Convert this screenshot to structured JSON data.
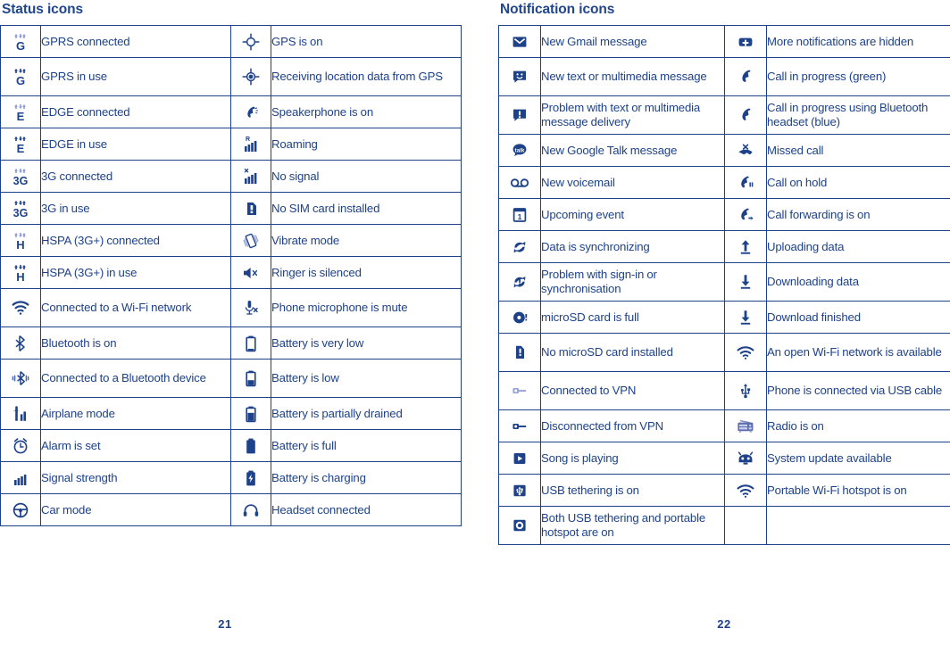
{
  "status_section": {
    "title": "Status icons",
    "page_number": "21",
    "rows": [
      {
        "left_icon": "gprs-connected-icon",
        "left_label": "GPRS connected",
        "right_icon": "gps-on-icon",
        "right_label": "GPS is on"
      },
      {
        "left_icon": "gprs-in-use-icon",
        "left_label": "GPRS in use",
        "right_icon": "gps-receiving-icon",
        "right_label": "Receiving location data from GPS"
      },
      {
        "left_icon": "edge-connected-icon",
        "left_label": "EDGE connected",
        "right_icon": "speakerphone-on-icon",
        "right_label": "Speakerphone is on"
      },
      {
        "left_icon": "edge-in-use-icon",
        "left_label": "EDGE in use",
        "right_icon": "roaming-icon",
        "right_label": "Roaming"
      },
      {
        "left_icon": "3g-connected-icon",
        "left_label": "3G connected",
        "right_icon": "no-signal-icon",
        "right_label": "No signal"
      },
      {
        "left_icon": "3g-in-use-icon",
        "left_label": "3G in use",
        "right_icon": "no-sim-card-icon",
        "right_label": "No SIM card installed"
      },
      {
        "left_icon": "hspa-connected-icon",
        "left_label": "HSPA (3G+) connected",
        "right_icon": "vibrate-mode-icon",
        "right_label": "Vibrate mode"
      },
      {
        "left_icon": "hspa-in-use-icon",
        "left_label": "HSPA (3G+) in use",
        "right_icon": "ringer-silenced-icon",
        "right_label": "Ringer is silenced"
      },
      {
        "left_icon": "wifi-connected-icon",
        "left_label": "Connected to a Wi-Fi network",
        "right_icon": "microphone-mute-icon",
        "right_label": "Phone microphone is mute"
      },
      {
        "left_icon": "bluetooth-on-icon",
        "left_label": "Bluetooth is on",
        "right_icon": "battery-very-low-icon",
        "right_label": "Battery is very low"
      },
      {
        "left_icon": "bluetooth-connected-icon",
        "left_label": "Connected to a Bluetooth device",
        "right_icon": "battery-low-icon",
        "right_label": "Battery is low"
      },
      {
        "left_icon": "airplane-mode-icon",
        "left_label": "Airplane mode",
        "right_icon": "battery-partial-icon",
        "right_label": "Battery is partially drained"
      },
      {
        "left_icon": "alarm-set-icon",
        "left_label": "Alarm is set",
        "right_icon": "battery-full-icon",
        "right_label": "Battery is full"
      },
      {
        "left_icon": "signal-strength-icon",
        "left_label": "Signal strength",
        "right_icon": "battery-charging-icon",
        "right_label": "Battery is charging"
      },
      {
        "left_icon": "car-mode-icon",
        "left_label": "Car mode",
        "right_icon": "headset-connected-icon",
        "right_label": "Headset connected"
      }
    ]
  },
  "notification_section": {
    "title": "Notification icons",
    "page_number": "22",
    "rows": [
      {
        "left_icon": "gmail-icon",
        "left_label": "New Gmail message",
        "right_icon": "more-notifications-icon",
        "right_label": "More notifications are hidden"
      },
      {
        "left_icon": "sms-message-icon",
        "left_label": "New text or multimedia message",
        "right_icon": "call-in-progress-icon",
        "right_label": "Call in progress (green)"
      },
      {
        "left_icon": "message-problem-icon",
        "left_label": "Problem with text or multimedia message delivery",
        "right_icon": "call-bluetooth-icon",
        "right_label": "Call in progress using Bluetooth headset (blue)"
      },
      {
        "left_icon": "google-talk-icon",
        "left_label": "New Google Talk message",
        "right_icon": "missed-call-icon",
        "right_label": "Missed call"
      },
      {
        "left_icon": "voicemail-icon",
        "left_label": "New voicemail",
        "right_icon": "call-on-hold-icon",
        "right_label": "Call on hold"
      },
      {
        "left_icon": "calendar-event-icon",
        "left_label": "Upcoming event",
        "right_icon": "call-forwarding-icon",
        "right_label": "Call forwarding is on"
      },
      {
        "left_icon": "sync-icon",
        "left_label": "Data is synchronizing",
        "right_icon": "upload-icon",
        "right_label": "Uploading data"
      },
      {
        "left_icon": "sync-problem-icon",
        "left_label": "Problem with sign-in or synchronisation",
        "right_icon": "download-icon",
        "right_label": "Downloading data"
      },
      {
        "left_icon": "sd-card-full-icon",
        "left_label": "microSD card is full",
        "right_icon": "download-finished-icon",
        "right_label": "Download finished"
      },
      {
        "left_icon": "no-sd-card-icon",
        "left_label": "No microSD card installed",
        "right_icon": "open-wifi-icon",
        "right_label": "An open Wi-Fi network is available"
      },
      {
        "left_icon": "vpn-connected-icon",
        "left_label": "Connected to VPN",
        "right_icon": "usb-cable-icon",
        "right_label": "Phone is connected via USB cable"
      },
      {
        "left_icon": "vpn-disconnected-icon",
        "left_label": "Disconnected from VPN",
        "right_icon": "radio-on-icon",
        "right_label": "Radio is on"
      },
      {
        "left_icon": "music-playing-icon",
        "left_label": "Song is playing",
        "right_icon": "system-update-icon",
        "right_label": "System update available"
      },
      {
        "left_icon": "usb-tethering-icon",
        "left_label": "USB tethering is on",
        "right_icon": "portable-hotspot-icon",
        "right_label": "Portable Wi-Fi hotspot is on"
      },
      {
        "left_icon": "tethering-and-hotspot-icon",
        "left_label": "Both USB tethering and portable hotspot are on",
        "right_icon": "",
        "right_label": ""
      }
    ]
  },
  "colors": {
    "ink": "#1d4289",
    "border": "#1d4289",
    "light_accent": "#8e9bd4"
  }
}
